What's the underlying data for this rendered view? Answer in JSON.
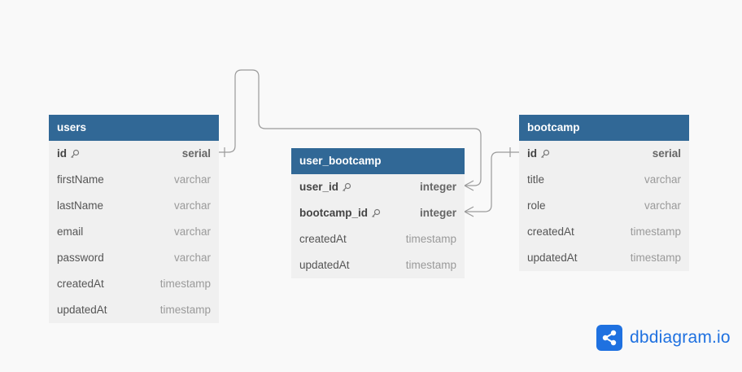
{
  "tables": {
    "users": {
      "name": "users",
      "columns": [
        {
          "name": "id",
          "type": "serial",
          "pk": true
        },
        {
          "name": "firstName",
          "type": "varchar"
        },
        {
          "name": "lastName",
          "type": "varchar"
        },
        {
          "name": "email",
          "type": "varchar"
        },
        {
          "name": "password",
          "type": "varchar"
        },
        {
          "name": "createdAt",
          "type": "timestamp"
        },
        {
          "name": "updatedAt",
          "type": "timestamp"
        }
      ]
    },
    "user_bootcamp": {
      "name": "user_bootcamp",
      "columns": [
        {
          "name": "user_id",
          "type": "integer",
          "pk": true
        },
        {
          "name": "bootcamp_id",
          "type": "integer",
          "pk": true
        },
        {
          "name": "createdAt",
          "type": "timestamp"
        },
        {
          "name": "updatedAt",
          "type": "timestamp"
        }
      ]
    },
    "bootcamp": {
      "name": "bootcamp",
      "columns": [
        {
          "name": "id",
          "type": "serial",
          "pk": true
        },
        {
          "name": "title",
          "type": "varchar"
        },
        {
          "name": "role",
          "type": "varchar"
        },
        {
          "name": "createdAt",
          "type": "timestamp"
        },
        {
          "name": "updatedAt",
          "type": "timestamp"
        }
      ]
    }
  },
  "relations": [
    {
      "from": "users.id",
      "to": "user_bootcamp.user_id",
      "from_cardinality": "one",
      "to_cardinality": "many"
    },
    {
      "from": "bootcamp.id",
      "to": "user_bootcamp.bootcamp_id",
      "from_cardinality": "one",
      "to_cardinality": "many"
    }
  ],
  "brand": {
    "text": "dbdiagram.io",
    "icon": "share-nodes-icon",
    "color": "#1f71e0"
  },
  "colors": {
    "header": "#316896",
    "connector": "#9a9a9a",
    "background": "#f9f9f9"
  }
}
